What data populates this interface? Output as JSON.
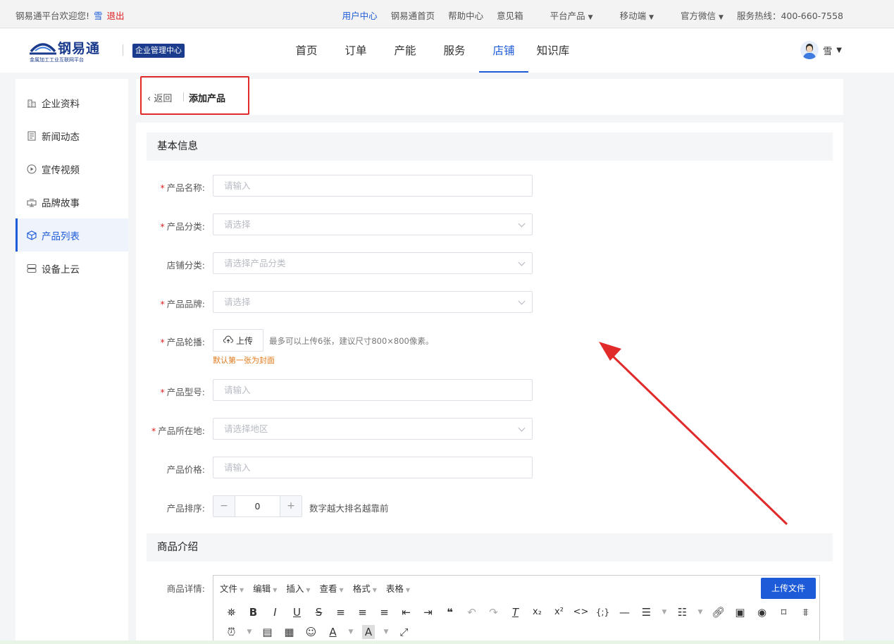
{
  "topbar": {
    "welcome": "钢易通平台欢迎您!",
    "user": "雪",
    "logout": "退出",
    "links": [
      "用户中心",
      "钢易通首页",
      "帮助中心",
      "意见箱",
      "平台产品",
      "移动端",
      "官方微信",
      "服务热线：400-660-7558"
    ],
    "active_link": "用户中心"
  },
  "header": {
    "brand": "钢易通",
    "slogan": "金属加工工业互联网平台",
    "center_badge": "企业管理中心",
    "nav": [
      "首页",
      "订单",
      "产能",
      "服务",
      "店铺",
      "知识库"
    ],
    "active_nav": "店铺",
    "user_name": "雪"
  },
  "sidebar": {
    "items": [
      {
        "label": "企业资料",
        "icon": "building-icon"
      },
      {
        "label": "新闻动态",
        "icon": "news-icon"
      },
      {
        "label": "宣传视频",
        "icon": "play-icon"
      },
      {
        "label": "品牌故事",
        "icon": "story-icon"
      },
      {
        "label": "产品列表",
        "icon": "box-icon"
      },
      {
        "label": "设备上云",
        "icon": "server-icon"
      }
    ],
    "active": "产品列表"
  },
  "breadcrumb": {
    "back": "返回",
    "current": "添加产品"
  },
  "form": {
    "section_basic": "基本信息",
    "fields": {
      "name": {
        "label": "产品名称:",
        "placeholder": "请输入",
        "required": true
      },
      "category": {
        "label": "产品分类:",
        "placeholder": "请选择",
        "required": true
      },
      "shop_category": {
        "label": "店铺分类:",
        "placeholder": "请选择产品分类",
        "required": false
      },
      "brand": {
        "label": "产品品牌:",
        "placeholder": "请选择",
        "required": true
      },
      "carousel": {
        "label": "产品轮播:",
        "button": "上传",
        "tip": "最多可以上传6张，建议尺寸800×800像素。",
        "sub": "默认第一张为封面",
        "required": true
      },
      "model": {
        "label": "产品型号:",
        "placeholder": "请输入",
        "required": true
      },
      "location": {
        "label": "产品所在地:",
        "placeholder": "请选择地区",
        "required": true
      },
      "price": {
        "label": "产品价格:",
        "placeholder": "请输入",
        "required": false
      },
      "sort": {
        "label": "产品排序:",
        "value": "0",
        "tip": "数字越大排名越靠前",
        "minus": "−",
        "plus": "+"
      }
    },
    "section_intro": "商品介绍",
    "detail_label": "商品详情:"
  },
  "editor": {
    "menus": [
      "文件",
      "编辑",
      "插入",
      "查看",
      "格式",
      "表格"
    ],
    "upload_button": "上传文件"
  },
  "colors": {
    "accent": "#1e5bd8",
    "brand": "#1b3b8c",
    "required": "#e02020",
    "annotation": "#e12a2a"
  }
}
